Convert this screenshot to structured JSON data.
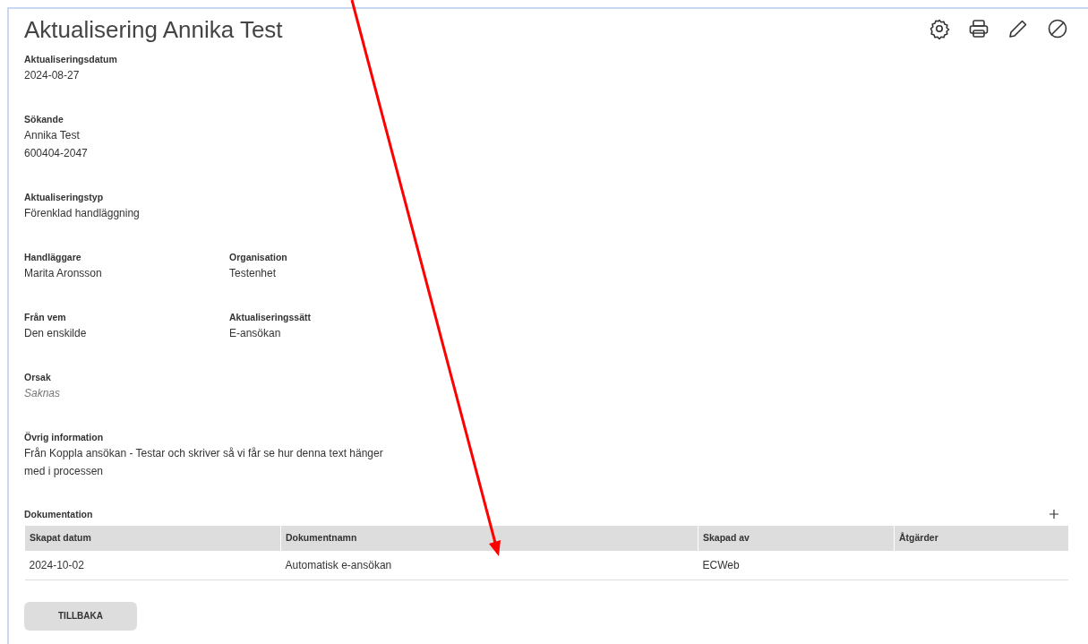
{
  "title": "Aktualisering Annika Test",
  "sections": [
    {
      "fields": [
        {
          "label": "Aktualiseringsdatum",
          "values": [
            "2024-08-27"
          ],
          "missing": false
        }
      ]
    },
    {
      "fields": [
        {
          "label": "Sökande",
          "values": [
            "Annika Test",
            "600404-2047"
          ],
          "missing": false
        }
      ]
    },
    {
      "fields": [
        {
          "label": "Aktualiseringstyp",
          "values": [
            "Förenklad handläggning"
          ],
          "missing": false
        }
      ]
    },
    {
      "fields": [
        {
          "label": "Handläggare",
          "values": [
            "Marita Aronsson"
          ],
          "missing": false
        },
        {
          "label": "Organisation",
          "values": [
            "Testenhet"
          ],
          "missing": false
        }
      ]
    },
    {
      "fields": [
        {
          "label": "Från vem",
          "values": [
            "Den enskilde"
          ],
          "missing": false
        },
        {
          "label": "Aktualiseringssätt",
          "values": [
            "E-ansökan"
          ],
          "missing": false
        }
      ]
    },
    {
      "fields": [
        {
          "label": "Orsak",
          "values": [
            "Saknas"
          ],
          "missing": true
        }
      ]
    },
    {
      "fields": [
        {
          "label": "Övrig information",
          "values": [
            "Från Koppla ansökan - Testar och skriver så vi får se hur denna text hänger med i processen"
          ],
          "missing": false
        }
      ]
    }
  ],
  "documentation": {
    "title": "Dokumentation",
    "columns": [
      "Skapat datum",
      "Dokumentnamn",
      "Skapad av",
      "Åtgärder"
    ],
    "rows": [
      {
        "cells": [
          "2024-10-02",
          "Automatisk e-ansökan",
          "ECWeb"
        ]
      }
    ]
  },
  "buttons": [
    {
      "label": "TILLBAKA"
    }
  ]
}
